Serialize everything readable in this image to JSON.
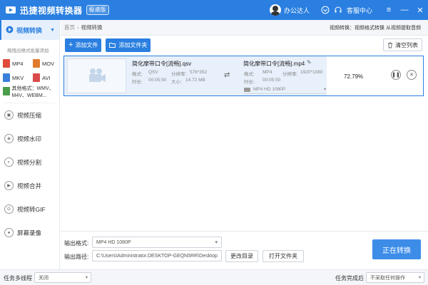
{
  "titlebar": {
    "app_title": "迅捷视频转换器",
    "version_badge": "极速版",
    "user_name": "办公达人",
    "service_label": "客服中心"
  },
  "sidebar": {
    "active": {
      "label": "视频转换"
    },
    "hint": "拖拽出格式批量添加",
    "formats": [
      {
        "label": "MP4",
        "color": "#e04a3a"
      },
      {
        "label": "MOV",
        "color": "#e07a2a"
      },
      {
        "label": "MKV",
        "color": "#3a7fd9"
      },
      {
        "label": "AVI",
        "color": "#d94a4a"
      }
    ],
    "other_formats": "其他格式：WMV、M4V、WEBM...",
    "items": [
      {
        "label": "视频压缩"
      },
      {
        "label": "视频水印"
      },
      {
        "label": "视频分割"
      },
      {
        "label": "视频合并"
      },
      {
        "label": "视频转GIF"
      },
      {
        "label": "屏幕录像"
      }
    ]
  },
  "breadcrumb": {
    "home": "首页",
    "separator": "›",
    "current": "视频转换",
    "right_text": "视频转换：视频格式转换 从视频提取音频"
  },
  "toolbar": {
    "add_file": "添加文件",
    "add_folder": "添加文件夹",
    "clear_list": "清空列表"
  },
  "task": {
    "source": {
      "name": "简化摩带口令[流畅].qsv",
      "format_label": "格式:",
      "format": "QSV",
      "resolution_label": "分辨率:",
      "resolution": "576*352",
      "duration_label": "时长:",
      "duration": "00:05:50",
      "size_label": "大小:",
      "size": "14.72 MB"
    },
    "target": {
      "name": "简化摩带口令[流畅].mp4",
      "format_label": "格式:",
      "format": "MP4",
      "resolution_label": "分辨率:",
      "resolution": "1920*1080",
      "duration_label": "时长:",
      "duration": "00:05:50",
      "preset": "MP4   HD 1080P"
    },
    "progress": "72.79%"
  },
  "output": {
    "format_label": "输出格式:",
    "format_value": "MP4   HD 1080P",
    "path_label": "输出路径:",
    "path_value": "C:\\Users\\Administrator.DESKTOP-GEQN5RR\\Desktop",
    "change_dir": "更改目录",
    "open_folder": "打开文件夹",
    "start_button": "正在转换"
  },
  "statusbar": {
    "multithread_label": "任务多线程",
    "multithread_value": "关闭",
    "after_label": "任务完成后",
    "after_value": "不采取任何操作"
  },
  "colors": {
    "accent": "#2a7fe0",
    "start_button": "#3d8de8"
  }
}
